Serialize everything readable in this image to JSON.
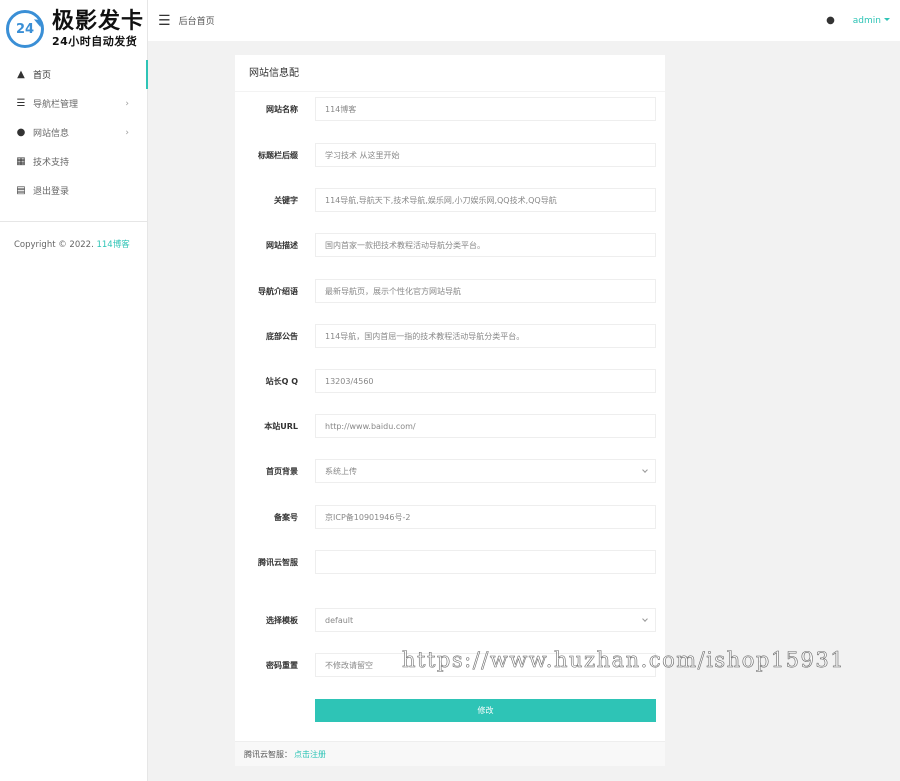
{
  "logo": {
    "badge": "24",
    "main": "极影发卡",
    "sub": "24小时自动发货"
  },
  "sidebar": {
    "items": [
      {
        "label": "首页",
        "icon": "home-icon"
      },
      {
        "label": "导航栏管理",
        "icon": "list-icon"
      },
      {
        "label": "网站信息",
        "icon": "palette-icon"
      },
      {
        "label": "技术支持",
        "icon": "id-card-icon"
      },
      {
        "label": "退出登录",
        "icon": "logout-icon"
      }
    ],
    "copyright_prefix": "Copyright © 2022.",
    "copyright_link": "114博客"
  },
  "topbar": {
    "breadcrumb": "后台首页",
    "user": "admin"
  },
  "card": {
    "title": "网站信息配",
    "fields": [
      {
        "label": "网站名称",
        "value": "114博客"
      },
      {
        "label": "标题栏后缀",
        "value": "学习技术 从这里开始"
      },
      {
        "label": "关键字",
        "value": "114导航,导航天下,技术导航,娱乐网,小刀娱乐网,QQ技术,QQ导航"
      },
      {
        "label": "网站描述",
        "value": "国内首家一款把技术教程活动导航分类平台。"
      },
      {
        "label": "导航介绍语",
        "value": "最新导航页，展示个性化官方网站导航"
      },
      {
        "label": "底部公告",
        "value": "114导航，国内首屈一指的技术教程活动导航分类平台。"
      },
      {
        "label": "站长Q Q",
        "value": "13203/4560"
      },
      {
        "label": "本站URL",
        "value": "http://www.baidu.com/"
      },
      {
        "label": "首页背景",
        "value": "系统上传"
      },
      {
        "label": "备案号",
        "value": "京ICP备10901946号-2"
      },
      {
        "label": "腾讯云智服",
        "value": ""
      },
      {
        "label": "选择模板",
        "value": "default"
      },
      {
        "label": "密码重置",
        "value": "",
        "placeholder": "不修改请留空"
      }
    ],
    "submit_label": "修改",
    "footer_label": "腾讯云智服：",
    "footer_link": "点击注册"
  },
  "watermark": "https://www.huzhan.com/ishop15931"
}
